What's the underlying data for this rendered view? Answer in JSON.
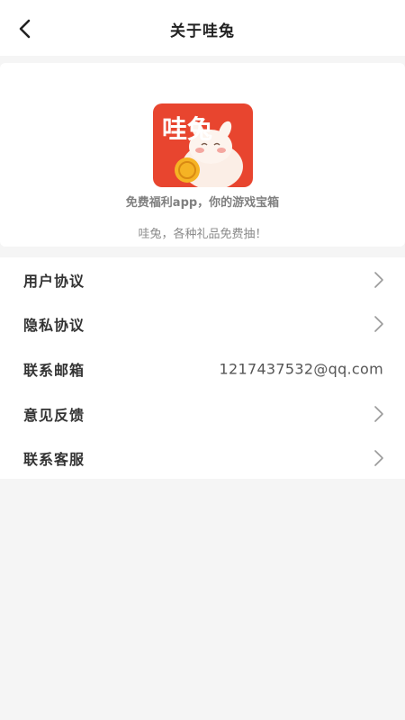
{
  "header": {
    "title": "关于哇兔"
  },
  "about": {
    "logo_text": "哇兔",
    "tagline": "免费福利app，你的游戏宝箱",
    "slogan": "哇兔，各种礼品免费抽！",
    "brand_color": "#e8452f"
  },
  "menu": {
    "items": [
      {
        "label": "用户协议",
        "icon": "chevron-right-icon"
      },
      {
        "label": "隐私协议",
        "icon": "chevron-right-icon"
      },
      {
        "label": "联系邮箱",
        "value": "1217437532@qq.com"
      },
      {
        "label": "意见反馈",
        "icon": "chevron-right-icon"
      },
      {
        "label": "联系客服",
        "icon": "chevron-right-icon"
      }
    ]
  }
}
